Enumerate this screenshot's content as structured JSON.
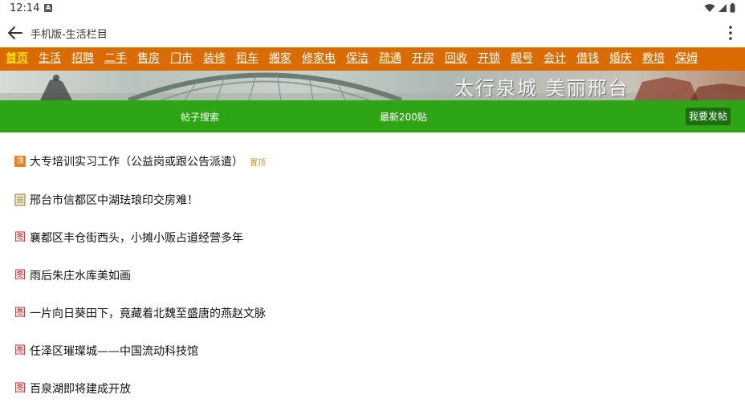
{
  "status": {
    "time": "12:14",
    "notif_letter": "A"
  },
  "app_bar": {
    "title": "手机版-生活栏目"
  },
  "nav": {
    "items": [
      "首页",
      "生活",
      "招聘",
      "二手",
      "售房",
      "门市",
      "装修",
      "租车",
      "搬家",
      "修家电",
      "保洁",
      "疏通",
      "开房",
      "回收",
      "开锁",
      "靓号",
      "会计",
      "借钱",
      "婚庆",
      "教培",
      "保姆"
    ]
  },
  "banner": {
    "text": "太行泉城 美丽邢台"
  },
  "actions": {
    "search": "帖子搜索",
    "latest": "最新200贴",
    "post": "我要发帖"
  },
  "icons": {
    "top_badge": "顶",
    "image_badge": "图"
  },
  "posts": [
    {
      "title": "大专培训实习工作（公益岗或跟公告派遣）",
      "tag": "置顶",
      "icon": "top-icon"
    },
    {
      "title": "邢台市信都区中湖珐琅印交房难！",
      "icon": "note-icon"
    },
    {
      "title": "襄都区丰仓街西头，小摊小贩占道经营多年",
      "icon": "image-icon"
    },
    {
      "title": "雨后朱庄水库美如画",
      "icon": "image-icon"
    },
    {
      "title": "一片向日葵田下，竟藏着北魏至盛唐的燕赵文脉",
      "icon": "image-icon"
    },
    {
      "title": "任泽区璀璨城——中国流动科技馆",
      "icon": "image-icon"
    },
    {
      "title": "百泉湖即将建成开放",
      "icon": "image-icon"
    }
  ],
  "colors": {
    "nav_bg": "#d96b00",
    "nav_active": "#ffe600",
    "action_bg": "#2ea515",
    "post_btn_bg": "#1c6d0f",
    "tag": "#c2961d",
    "image_icon": "#d32020"
  }
}
